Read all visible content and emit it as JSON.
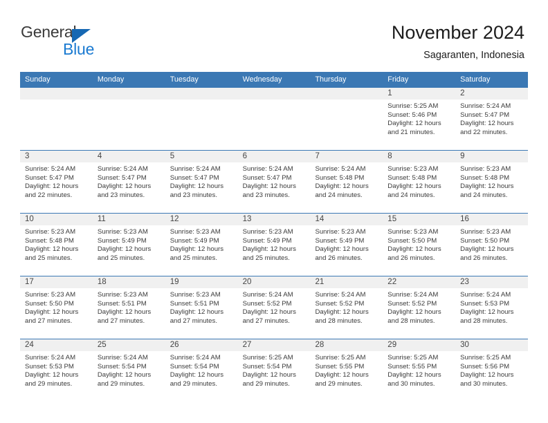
{
  "brand": {
    "name_part1": "General",
    "name_part2": "Blue",
    "triangle_color": "#1668b3",
    "blue_color": "#1a7ad1"
  },
  "header": {
    "title": "November 2024",
    "subtitle": "Sagaranten, Indonesia"
  },
  "colors": {
    "header_blue": "#3b78b4",
    "row_band_gray": "#f0f0f0",
    "text": "#3a3a3a"
  },
  "weekdays": [
    "Sunday",
    "Monday",
    "Tuesday",
    "Wednesday",
    "Thursday",
    "Friday",
    "Saturday"
  ],
  "weeks": [
    [
      {
        "day": "",
        "sunrise": "",
        "sunset": "",
        "daylight1": "",
        "daylight2": ""
      },
      {
        "day": "",
        "sunrise": "",
        "sunset": "",
        "daylight1": "",
        "daylight2": ""
      },
      {
        "day": "",
        "sunrise": "",
        "sunset": "",
        "daylight1": "",
        "daylight2": ""
      },
      {
        "day": "",
        "sunrise": "",
        "sunset": "",
        "daylight1": "",
        "daylight2": ""
      },
      {
        "day": "",
        "sunrise": "",
        "sunset": "",
        "daylight1": "",
        "daylight2": ""
      },
      {
        "day": "1",
        "sunrise": "Sunrise: 5:25 AM",
        "sunset": "Sunset: 5:46 PM",
        "daylight1": "Daylight: 12 hours",
        "daylight2": "and 21 minutes."
      },
      {
        "day": "2",
        "sunrise": "Sunrise: 5:24 AM",
        "sunset": "Sunset: 5:47 PM",
        "daylight1": "Daylight: 12 hours",
        "daylight2": "and 22 minutes."
      }
    ],
    [
      {
        "day": "3",
        "sunrise": "Sunrise: 5:24 AM",
        "sunset": "Sunset: 5:47 PM",
        "daylight1": "Daylight: 12 hours",
        "daylight2": "and 22 minutes."
      },
      {
        "day": "4",
        "sunrise": "Sunrise: 5:24 AM",
        "sunset": "Sunset: 5:47 PM",
        "daylight1": "Daylight: 12 hours",
        "daylight2": "and 23 minutes."
      },
      {
        "day": "5",
        "sunrise": "Sunrise: 5:24 AM",
        "sunset": "Sunset: 5:47 PM",
        "daylight1": "Daylight: 12 hours",
        "daylight2": "and 23 minutes."
      },
      {
        "day": "6",
        "sunrise": "Sunrise: 5:24 AM",
        "sunset": "Sunset: 5:47 PM",
        "daylight1": "Daylight: 12 hours",
        "daylight2": "and 23 minutes."
      },
      {
        "day": "7",
        "sunrise": "Sunrise: 5:24 AM",
        "sunset": "Sunset: 5:48 PM",
        "daylight1": "Daylight: 12 hours",
        "daylight2": "and 24 minutes."
      },
      {
        "day": "8",
        "sunrise": "Sunrise: 5:23 AM",
        "sunset": "Sunset: 5:48 PM",
        "daylight1": "Daylight: 12 hours",
        "daylight2": "and 24 minutes."
      },
      {
        "day": "9",
        "sunrise": "Sunrise: 5:23 AM",
        "sunset": "Sunset: 5:48 PM",
        "daylight1": "Daylight: 12 hours",
        "daylight2": "and 24 minutes."
      }
    ],
    [
      {
        "day": "10",
        "sunrise": "Sunrise: 5:23 AM",
        "sunset": "Sunset: 5:48 PM",
        "daylight1": "Daylight: 12 hours",
        "daylight2": "and 25 minutes."
      },
      {
        "day": "11",
        "sunrise": "Sunrise: 5:23 AM",
        "sunset": "Sunset: 5:49 PM",
        "daylight1": "Daylight: 12 hours",
        "daylight2": "and 25 minutes."
      },
      {
        "day": "12",
        "sunrise": "Sunrise: 5:23 AM",
        "sunset": "Sunset: 5:49 PM",
        "daylight1": "Daylight: 12 hours",
        "daylight2": "and 25 minutes."
      },
      {
        "day": "13",
        "sunrise": "Sunrise: 5:23 AM",
        "sunset": "Sunset: 5:49 PM",
        "daylight1": "Daylight: 12 hours",
        "daylight2": "and 25 minutes."
      },
      {
        "day": "14",
        "sunrise": "Sunrise: 5:23 AM",
        "sunset": "Sunset: 5:49 PM",
        "daylight1": "Daylight: 12 hours",
        "daylight2": "and 26 minutes."
      },
      {
        "day": "15",
        "sunrise": "Sunrise: 5:23 AM",
        "sunset": "Sunset: 5:50 PM",
        "daylight1": "Daylight: 12 hours",
        "daylight2": "and 26 minutes."
      },
      {
        "day": "16",
        "sunrise": "Sunrise: 5:23 AM",
        "sunset": "Sunset: 5:50 PM",
        "daylight1": "Daylight: 12 hours",
        "daylight2": "and 26 minutes."
      }
    ],
    [
      {
        "day": "17",
        "sunrise": "Sunrise: 5:23 AM",
        "sunset": "Sunset: 5:50 PM",
        "daylight1": "Daylight: 12 hours",
        "daylight2": "and 27 minutes."
      },
      {
        "day": "18",
        "sunrise": "Sunrise: 5:23 AM",
        "sunset": "Sunset: 5:51 PM",
        "daylight1": "Daylight: 12 hours",
        "daylight2": "and 27 minutes."
      },
      {
        "day": "19",
        "sunrise": "Sunrise: 5:23 AM",
        "sunset": "Sunset: 5:51 PM",
        "daylight1": "Daylight: 12 hours",
        "daylight2": "and 27 minutes."
      },
      {
        "day": "20",
        "sunrise": "Sunrise: 5:24 AM",
        "sunset": "Sunset: 5:52 PM",
        "daylight1": "Daylight: 12 hours",
        "daylight2": "and 27 minutes."
      },
      {
        "day": "21",
        "sunrise": "Sunrise: 5:24 AM",
        "sunset": "Sunset: 5:52 PM",
        "daylight1": "Daylight: 12 hours",
        "daylight2": "and 28 minutes."
      },
      {
        "day": "22",
        "sunrise": "Sunrise: 5:24 AM",
        "sunset": "Sunset: 5:52 PM",
        "daylight1": "Daylight: 12 hours",
        "daylight2": "and 28 minutes."
      },
      {
        "day": "23",
        "sunrise": "Sunrise: 5:24 AM",
        "sunset": "Sunset: 5:53 PM",
        "daylight1": "Daylight: 12 hours",
        "daylight2": "and 28 minutes."
      }
    ],
    [
      {
        "day": "24",
        "sunrise": "Sunrise: 5:24 AM",
        "sunset": "Sunset: 5:53 PM",
        "daylight1": "Daylight: 12 hours",
        "daylight2": "and 29 minutes."
      },
      {
        "day": "25",
        "sunrise": "Sunrise: 5:24 AM",
        "sunset": "Sunset: 5:54 PM",
        "daylight1": "Daylight: 12 hours",
        "daylight2": "and 29 minutes."
      },
      {
        "day": "26",
        "sunrise": "Sunrise: 5:24 AM",
        "sunset": "Sunset: 5:54 PM",
        "daylight1": "Daylight: 12 hours",
        "daylight2": "and 29 minutes."
      },
      {
        "day": "27",
        "sunrise": "Sunrise: 5:25 AM",
        "sunset": "Sunset: 5:54 PM",
        "daylight1": "Daylight: 12 hours",
        "daylight2": "and 29 minutes."
      },
      {
        "day": "28",
        "sunrise": "Sunrise: 5:25 AM",
        "sunset": "Sunset: 5:55 PM",
        "daylight1": "Daylight: 12 hours",
        "daylight2": "and 29 minutes."
      },
      {
        "day": "29",
        "sunrise": "Sunrise: 5:25 AM",
        "sunset": "Sunset: 5:55 PM",
        "daylight1": "Daylight: 12 hours",
        "daylight2": "and 30 minutes."
      },
      {
        "day": "30",
        "sunrise": "Sunrise: 5:25 AM",
        "sunset": "Sunset: 5:56 PM",
        "daylight1": "Daylight: 12 hours",
        "daylight2": "and 30 minutes."
      }
    ]
  ]
}
